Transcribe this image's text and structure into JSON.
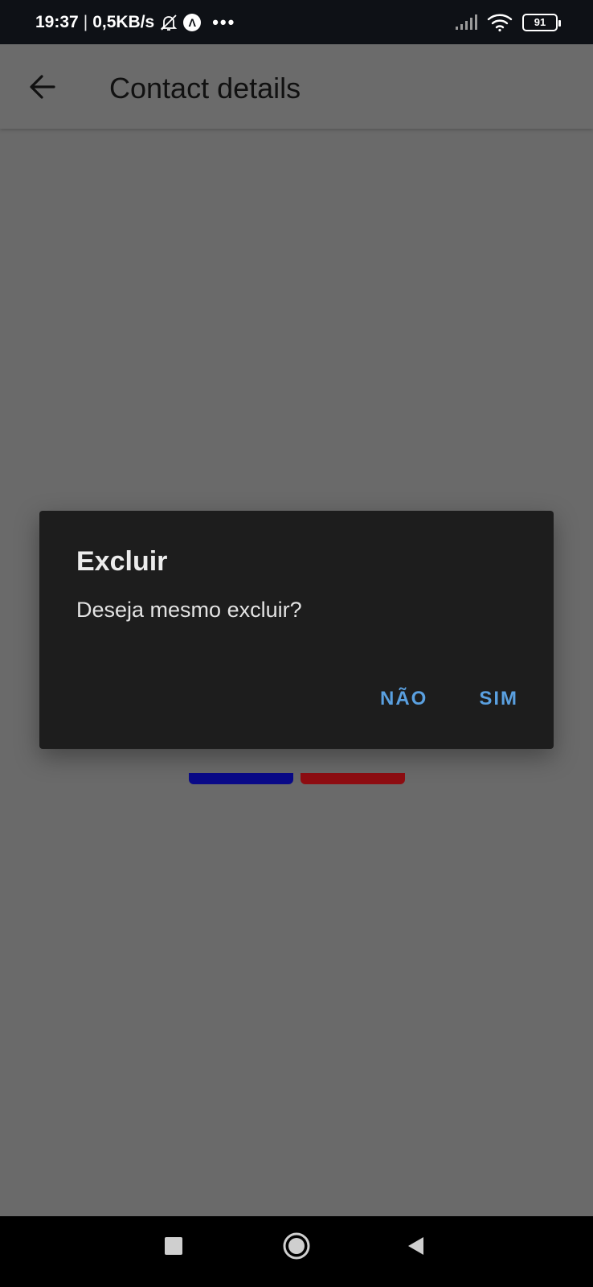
{
  "status_bar": {
    "time": "19:37",
    "separator": "|",
    "network_speed": "0,5KB/s",
    "notification_icon": "bell-off-icon",
    "app_badge": "Λ",
    "overflow": "•••",
    "battery_level": "91",
    "signal_icon": "signal-icon",
    "wifi_icon": "wifi-icon"
  },
  "app_bar": {
    "back_icon": "arrow-left-icon",
    "title": "Contact details"
  },
  "dialog": {
    "title": "Excluir",
    "message": "Deseja mesmo excluir?",
    "actions": {
      "no_label": "NÃO",
      "yes_label": "SIM"
    }
  },
  "navigation_bar": {
    "recents_icon": "square-icon",
    "home_icon": "circle-icon",
    "back_icon": "triangle-back-icon"
  },
  "colors": {
    "scrim": "#6a6a6a",
    "dialog_bg": "#1d1d1d",
    "action_text": "#5aa0e0",
    "hidden_button_blue": "#0a0a88",
    "hidden_button_red": "#8e0d12"
  }
}
